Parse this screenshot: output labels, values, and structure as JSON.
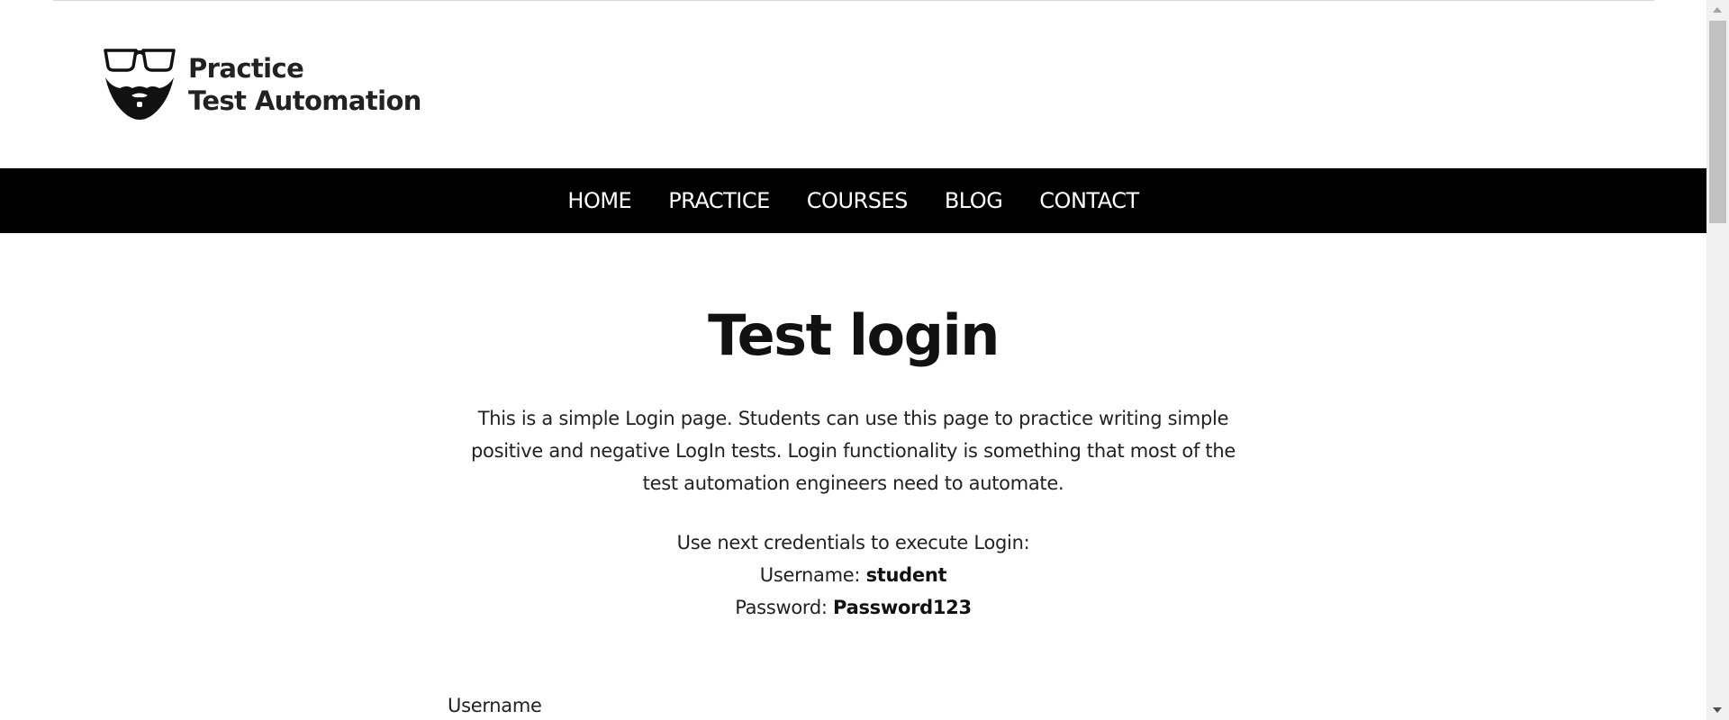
{
  "header": {
    "logo_line1": "Practice",
    "logo_line2": "Test Automation"
  },
  "nav": {
    "items": [
      "HOME",
      "PRACTICE",
      "COURSES",
      "BLOG",
      "CONTACT"
    ]
  },
  "main": {
    "title": "Test login",
    "intro": "This is a simple Login page. Students can use this page to practice writing simple positive and negative LogIn tests. Login functionality is something that most of the test automation engineers need to automate.",
    "credentials_intro": "Use next credentials to execute Login:",
    "username_label": "Username:",
    "username_value": "student",
    "password_label": "Password:",
    "password_value": "Password123"
  },
  "form": {
    "username_label": "Username"
  },
  "icons": {
    "logo": "glasses-beard-icon",
    "scroll_up": "scroll-up-arrow-icon",
    "scroll_down": "scroll-down-arrow-icon"
  },
  "colors": {
    "nav_background": "#000000",
    "nav_text": "#ffffff",
    "text": "#111111"
  }
}
